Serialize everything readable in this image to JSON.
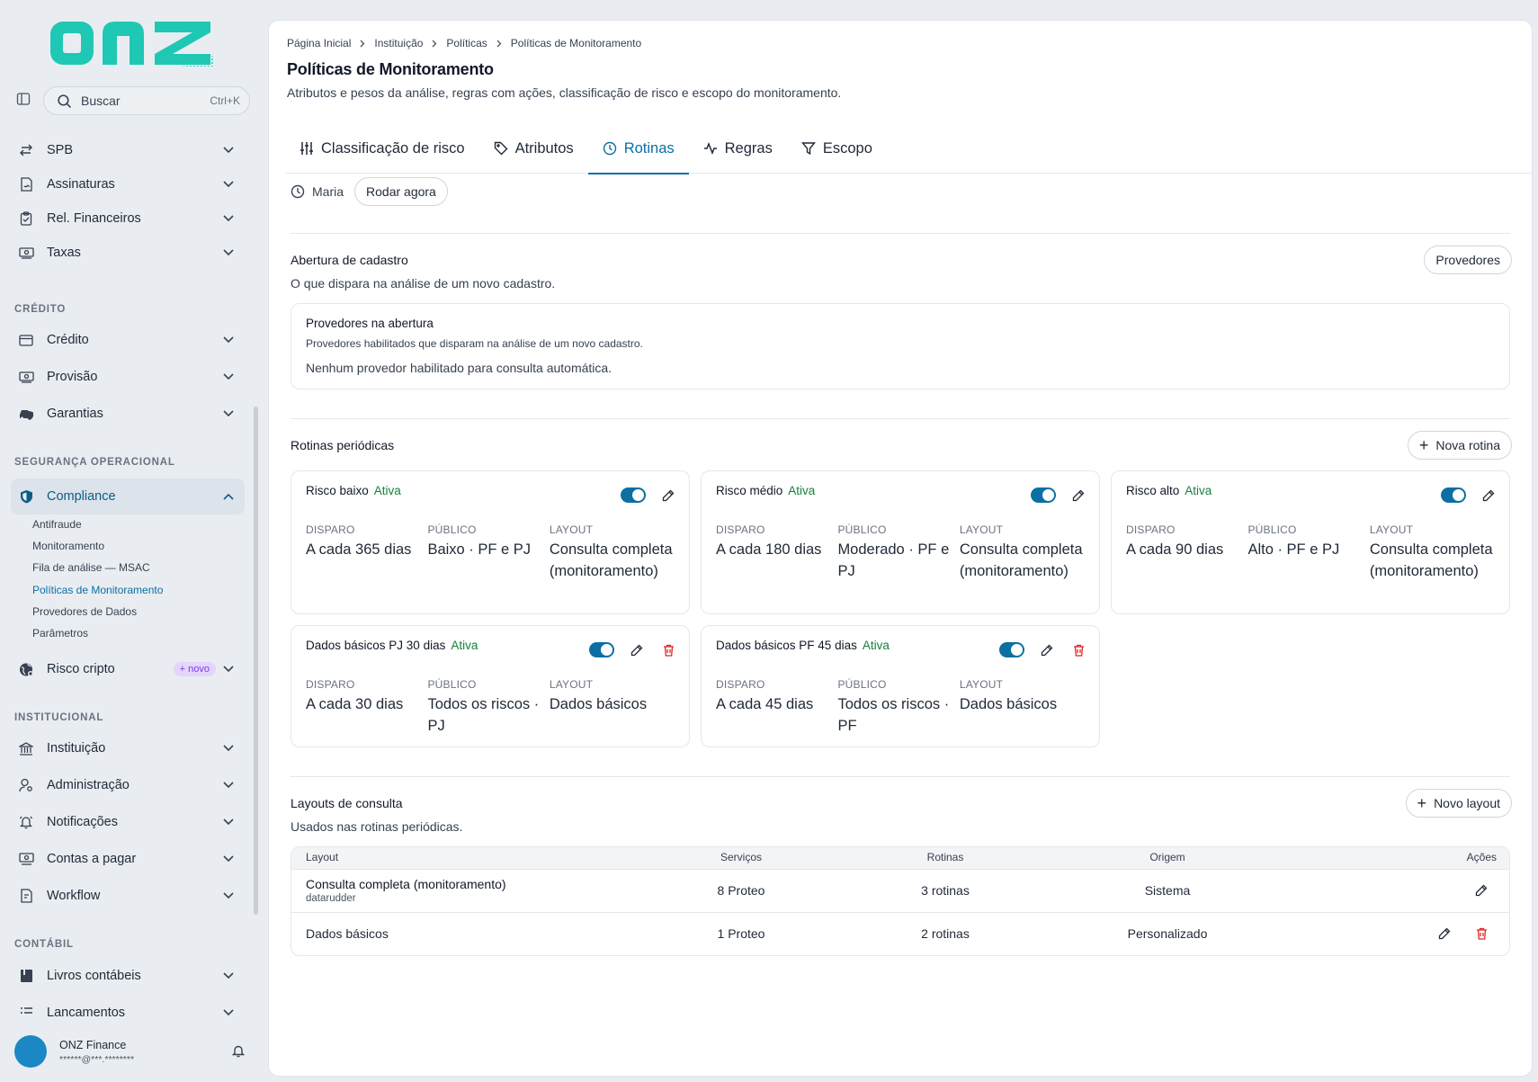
{
  "brand": {
    "logo_text": "onz",
    "accent": "#1ec8b4",
    "primary": "#0b6fa4",
    "danger": "#dc2626",
    "success": "#16803c"
  },
  "sidebar": {
    "search": {
      "label": "Buscar",
      "shortcut": "Ctrl+K"
    },
    "top_items": [
      {
        "label": "SPB",
        "icon": "transfer-icon"
      },
      {
        "label": "Assinaturas",
        "icon": "document-sign-icon"
      },
      {
        "label": "Rel. Financeiros",
        "icon": "clipboard-icon"
      },
      {
        "label": "Taxas",
        "icon": "money-icon"
      }
    ],
    "sections": {
      "credito": {
        "title": "CRÉDITO",
        "items": [
          "Crédito",
          "Provisão",
          "Garantias"
        ]
      },
      "seguranca": {
        "title": "SEGURANÇA OPERACIONAL"
      },
      "institucional": {
        "title": "INSTITUCIONAL",
        "items": [
          "Instituição",
          "Administração",
          "Notificações",
          "Contas a pagar",
          "Workflow"
        ]
      },
      "contabil": {
        "title": "CONTÁBIL",
        "items": [
          "Livros contábeis",
          "Lançamentos"
        ]
      }
    },
    "compliance": {
      "label": "Compliance",
      "sub_items": [
        "Antifraude",
        "Monitoramento",
        "Fila de análise — MSAC",
        "Políticas de Monitoramento",
        "Provedores de Dados",
        "Parâmetros"
      ],
      "active_sub": "Políticas de Monitoramento"
    },
    "risco_cripto": {
      "label": "Risco cripto",
      "badge": "+ novo"
    },
    "user": {
      "name": "ONZ Finance",
      "email": "******@***.********"
    }
  },
  "header": {
    "breadcrumb": [
      "Página Inicial",
      "Instituição",
      "Políticas",
      "Políticas de Monitoramento"
    ],
    "title": "Políticas de Monitoramento",
    "subtitle": "Atributos e pesos da análise, regras com ações, classificação de risco e escopo do monitoramento."
  },
  "tabs": [
    {
      "label": "Classificação de risco",
      "icon": "sliders-icon"
    },
    {
      "label": "Atributos",
      "icon": "tag-icon"
    },
    {
      "label": "Rotinas",
      "icon": "clock-icon",
      "active": true
    },
    {
      "label": "Regras",
      "icon": "activity-icon"
    },
    {
      "label": "Escopo",
      "icon": "filter-icon"
    }
  ],
  "runbar": {
    "user": "Maria",
    "run_now": "Rodar agora"
  },
  "abertura": {
    "title": "Abertura de cadastro",
    "desc": "O que dispara na análise de um novo cadastro.",
    "button": "Provedores",
    "box_title": "Provedores na abertura",
    "box_desc": "Provedores habilitados que disparam na análise de um novo cadastro.",
    "box_empty": "Nenhum provedor habilitado para consulta automática."
  },
  "rotinas": {
    "title": "Rotinas periódicas",
    "button": "Nova rotina",
    "col_labels": {
      "disparo": "DISPARO",
      "publico": "PÚBLICO",
      "layout": "LAYOUT"
    },
    "cards": [
      {
        "name": "Risco baixo",
        "status": "Ativa",
        "enabled": true,
        "deletable": false,
        "disparo": "A cada 365 dias",
        "publico": "Baixo · PF e PJ",
        "layout": "Consulta completa (monitoramento)"
      },
      {
        "name": "Risco médio",
        "status": "Ativa",
        "enabled": true,
        "deletable": false,
        "disparo": "A cada 180 dias",
        "publico": "Moderado · PF e PJ",
        "layout": "Consulta completa (monitoramento)"
      },
      {
        "name": "Risco alto",
        "status": "Ativa",
        "enabled": true,
        "deletable": false,
        "disparo": "A cada 90 dias",
        "publico": "Alto · PF e PJ",
        "layout": "Consulta completa (monitoramento)"
      },
      {
        "name": "Dados básicos PJ 30 dias",
        "status": "Ativa",
        "enabled": true,
        "deletable": true,
        "disparo": "A cada 30 dias",
        "publico": "Todos os riscos · PJ",
        "layout": "Dados básicos"
      },
      {
        "name": "Dados básicos PF 45 dias",
        "status": "Ativa",
        "enabled": true,
        "deletable": true,
        "disparo": "A cada 45 dias",
        "publico": "Todos os riscos · PF",
        "layout": "Dados básicos"
      }
    ]
  },
  "layouts": {
    "title": "Layouts de consulta",
    "desc": "Usados nas rotinas periódicas.",
    "button": "Novo layout",
    "headers": [
      "Layout",
      "Serviços",
      "Rotinas",
      "Origem",
      "Ações"
    ],
    "rows": [
      {
        "name": "Consulta completa (monitoramento)",
        "source": "datarudder",
        "servicos": "8 Proteo",
        "rotinas": "3 rotinas",
        "origem": "Sistema",
        "deletable": false
      },
      {
        "name": "Dados básicos",
        "source": "",
        "servicos": "1 Proteo",
        "rotinas": "2 rotinas",
        "origem": "Personalizado",
        "deletable": true
      }
    ]
  }
}
